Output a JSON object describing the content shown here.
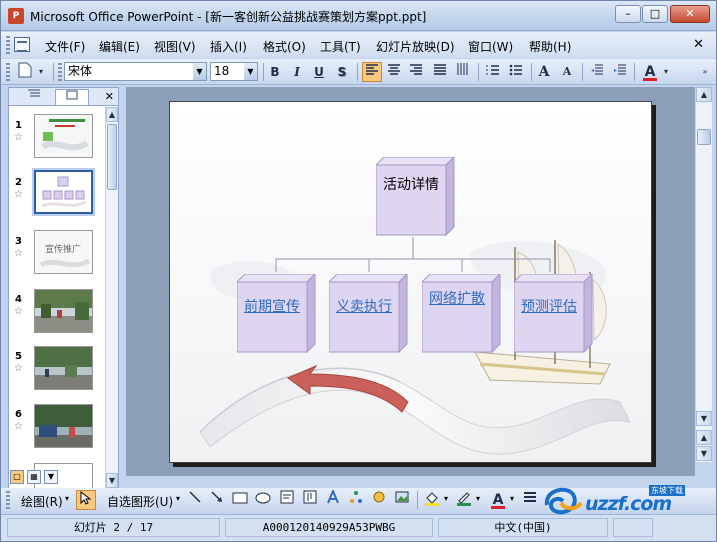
{
  "window": {
    "title": "Microsoft Office PowerPoint - [新一客创新公益挑战赛策划方案ppt.ppt]",
    "app_icon": "P"
  },
  "menu": {
    "items": [
      "文件(F)",
      "编辑(E)",
      "视图(V)",
      "插入(I)",
      "格式(O)",
      "工具(T)",
      "幻灯片放映(D)",
      "窗口(W)",
      "帮助(H)"
    ]
  },
  "format_toolbar": {
    "font_name": "宋体",
    "font_size": "18",
    "bold": "B",
    "italic": "I",
    "underline": "U",
    "shadow": "S",
    "align_left_active": true,
    "grow_font": "A",
    "shrink_font": "A",
    "font_color_label": "A",
    "font_color": "#d9202a"
  },
  "slide_pane": {
    "tab_outline_icon": "outline-icon",
    "tab_slides_icon": "slides-icon",
    "thumbnails": [
      {
        "num": "1",
        "selected": false,
        "kind": "title"
      },
      {
        "num": "2",
        "selected": true,
        "kind": "org"
      },
      {
        "num": "3",
        "selected": false,
        "kind": "section",
        "label": "宣传推广"
      },
      {
        "num": "4",
        "selected": false,
        "kind": "photo"
      },
      {
        "num": "5",
        "selected": false,
        "kind": "photo"
      },
      {
        "num": "6",
        "selected": false,
        "kind": "photo"
      }
    ]
  },
  "slide": {
    "root": "活动详情",
    "children": [
      "前期宣传",
      "义卖执行",
      "网络扩散",
      "预测评估"
    ],
    "box_color": "#d9cfee",
    "box_edge": "#a895c9",
    "link_color": "#2e6dbf"
  },
  "drawing_toolbar": {
    "draw_label": "绘图(R)",
    "autoshapes_label": "自选图形(U)"
  },
  "status": {
    "slide_info": "幻灯片 2 / 17",
    "design": "A000120140929A53PWBG",
    "language": "中文(中国)"
  },
  "watermark": {
    "brand": "uzzf.com",
    "tag": "东坡下载"
  }
}
